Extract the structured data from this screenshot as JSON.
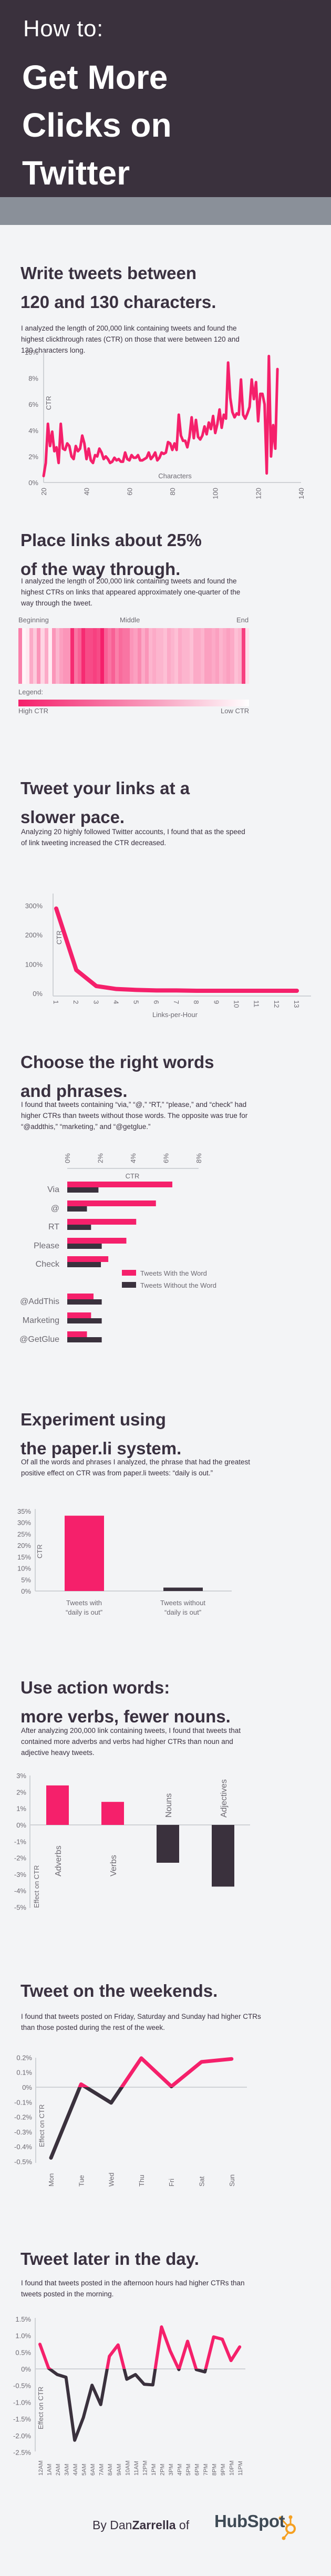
{
  "header": {
    "pretitle": "How to:",
    "title_lines": [
      "Get More",
      "Clicks on",
      "Twitter"
    ]
  },
  "colors": {
    "accent": "#f5206b",
    "dark": "#3a313d",
    "band": "#8a9099",
    "background": "#f3f4f6",
    "hubspot_orange": "#f5a022"
  },
  "sections": [
    {
      "title_lines": [
        "Write tweets between",
        "120 and 130 characters."
      ],
      "body": "I analyzed the length of 200,000 link containing tweets and found the highest clickthrough rates (CTR) on those that were between 120 and 130 characters long."
    },
    {
      "title_lines": [
        "Place links about 25%",
        "of the way through."
      ],
      "body": "I analyzed the length of 200,000 link containing tweets and found the highest CTRs on links that appeared approximately one-quarter of the way through the tweet."
    },
    {
      "title_lines": [
        "Tweet your links at a",
        "slower pace."
      ],
      "body": "Analyzing 20 highly followed Twitter accounts, I found that as the speed of link tweeting increased the CTR decreased."
    },
    {
      "title_lines": [
        "Choose the right words",
        "and phrases."
      ],
      "body": "I found that tweets containing “via,” “@,” “RT,” “please,” and “check” had higher CTRs than tweets without those words. The opposite was true for “@addthis,” “marketing,” and “@getglue.”"
    },
    {
      "title_lines": [
        "Experiment using",
        "the paper.li system."
      ],
      "body": "Of all the words and phrases I analyzed, the phrase that had the greatest positive effect on CTR was from paper.li tweets: “daily is out.”"
    },
    {
      "title_lines": [
        "Use action words:",
        "more verbs, fewer nouns."
      ],
      "body": "After analyzing 200,000 link containing tweets, I found that tweets that contained more adverbs and verbs had higher CTRs than noun and adjective heavy tweets."
    },
    {
      "title_lines": [
        "Tweet on the weekends."
      ],
      "body": "I found that tweets posted on Friday, Saturday and Sunday had higher CTRs than those posted during the rest of the week."
    },
    {
      "title_lines": [
        "Tweet later in the day."
      ],
      "body": "I found that tweets posted in the afternoon hours had higher CTRs than tweets posted in the morning."
    }
  ],
  "chart_data": [
    {
      "id": "length",
      "type": "line",
      "title": "",
      "xlabel": "Characters",
      "ylabel": "CTR",
      "xlim": [
        20,
        140
      ],
      "ylim": [
        0,
        10
      ],
      "xticks": [
        "20",
        "40",
        "60",
        "80",
        "100",
        "120",
        "140"
      ],
      "yticks": [
        "0%",
        "2%",
        "4%",
        "6%",
        "8%",
        "10%"
      ],
      "x": [
        20,
        21,
        22,
        23,
        24,
        25,
        26,
        27,
        28,
        29,
        30,
        31,
        32,
        33,
        34,
        35,
        36,
        37,
        38,
        39,
        40,
        41,
        42,
        43,
        44,
        45,
        46,
        47,
        48,
        49,
        50,
        51,
        52,
        53,
        54,
        55,
        56,
        57,
        58,
        59,
        60,
        61,
        62,
        63,
        64,
        65,
        66,
        67,
        68,
        69,
        70,
        71,
        72,
        73,
        74,
        75,
        76,
        77,
        78,
        79,
        80,
        81,
        82,
        83,
        84,
        85,
        86,
        87,
        88,
        89,
        90,
        91,
        92,
        93,
        94,
        95,
        96,
        97,
        98,
        99,
        100,
        101,
        102,
        103,
        104,
        105,
        106,
        107,
        108,
        109,
        110,
        111,
        112,
        113,
        114,
        115,
        116,
        117,
        118,
        119,
        120,
        121,
        122,
        123,
        124,
        125,
        126,
        127,
        128,
        129,
        130,
        131,
        132,
        133,
        134,
        135,
        136,
        137,
        138,
        139,
        140
      ],
      "values": [
        0.5,
        1.5,
        4.5,
        2.8,
        3.9,
        2.4,
        2.7,
        1.5,
        4.5,
        2.6,
        2.5,
        3.0,
        2.8,
        2.0,
        1.8,
        2.8,
        2.4,
        2.6,
        3.6,
        3.0,
        1.8,
        2.6,
        1.7,
        1.5,
        2.1,
        2.0,
        2.6,
        2.3,
        1.8,
        2.0,
        1.8,
        1.5,
        1.6,
        1.9,
        1.7,
        1.8,
        1.6,
        1.6,
        2.3,
        1.8,
        1.7,
        2.1,
        1.9,
        1.9,
        2.1,
        1.7,
        1.7,
        1.8,
        1.9,
        2.3,
        1.8,
        2.0,
        2.3,
        1.7,
        1.9,
        2.3,
        2.2,
        2.3,
        3.1,
        3.0,
        2.5,
        3.0,
        2.5,
        5.2,
        3.6,
        3.2,
        3.2,
        2.7,
        3.5,
        5.0,
        3.4,
        4.8,
        3.5,
        3.3,
        3.6,
        4.3,
        3.7,
        4.6,
        4.1,
        5.1,
        3.8,
        4.5,
        5.6,
        4.2,
        5.2,
        4.9,
        9.2,
        6.5,
        5.4,
        5.0,
        5.3,
        5.2,
        7.9,
        5.2,
        4.9,
        5.3,
        5.8,
        7.9,
        6.4,
        7.7,
        4.7,
        6.8,
        6.8,
        6.0,
        0.7,
        9.7,
        2.0,
        4.4,
        2.6,
        8.7
      ],
      "grid": false
    },
    {
      "id": "position",
      "type": "heatmap",
      "labels_top": [
        "Beginning",
        "Middle",
        "End"
      ],
      "legend_title": "Legend:",
      "legend_high": "High CTR",
      "legend_low": "Low CTR",
      "intensity": [
        0.55,
        0.0,
        0.05,
        0.35,
        0.2,
        0.45,
        0.15,
        0.35,
        0.05,
        0.45,
        0.3,
        0.4,
        0.45,
        0.45,
        0.95,
        0.6,
        0.7,
        0.95,
        0.8,
        0.8,
        0.85,
        0.8,
        1.0,
        0.7,
        0.6,
        0.7,
        0.55,
        0.65,
        0.6,
        0.6,
        0.45,
        0.4,
        0.5,
        0.35,
        0.45,
        0.3,
        0.35,
        0.3,
        0.3,
        0.25,
        0.35,
        0.3,
        0.25,
        0.35,
        0.3,
        0.3,
        0.25,
        0.35,
        0.35,
        0.3,
        0.4,
        0.4,
        0.35,
        0.4,
        0.3,
        0.35,
        0.4,
        0.35,
        0.25,
        0.3,
        0.85,
        0.1
      ]
    },
    {
      "id": "pace",
      "type": "line",
      "xlabel": "Links-per-Hour",
      "ylabel": "CTR",
      "ylim": [
        0,
        300
      ],
      "yticks": [
        "0%",
        "100%",
        "200%",
        "300%"
      ],
      "x": [
        "1",
        "2",
        "3",
        "4",
        "5",
        "6",
        "7",
        "8",
        "9",
        "10",
        "11",
        "12",
        "13"
      ],
      "values": [
        290,
        80,
        25,
        15,
        12,
        10,
        10,
        9,
        9,
        9,
        9,
        9,
        9
      ]
    },
    {
      "id": "words",
      "type": "bar",
      "orientation": "horizontal",
      "xlabel": "CTR",
      "xlim": [
        0,
        8
      ],
      "xticks": [
        "0%",
        "2%",
        "4%",
        "6%",
        "8%"
      ],
      "categories": [
        "Via",
        "@",
        "RT",
        "Please",
        "Check",
        "@AddThis",
        "Marketing",
        "@GetGlue"
      ],
      "series": [
        {
          "name": "Tweets With the Word",
          "values": [
            6.4,
            5.4,
            4.2,
            3.6,
            2.5,
            1.6,
            1.45,
            1.2
          ]
        },
        {
          "name": "Tweets Without the Word",
          "values": [
            1.9,
            1.2,
            1.45,
            2.1,
            2.05,
            2.1,
            2.1,
            2.1
          ]
        }
      ],
      "legend": "right"
    },
    {
      "id": "paperli",
      "type": "bar",
      "ylabel": "CTR",
      "ylim": [
        0,
        35
      ],
      "yticks": [
        "0%",
        "5%",
        "10%",
        "15%",
        "20%",
        "25%",
        "30%",
        "35%"
      ],
      "categories": [
        [
          "Tweets with",
          "“daily is out”"
        ],
        [
          "Tweets without",
          "“daily is out”"
        ]
      ],
      "values": [
        33,
        1.5
      ]
    },
    {
      "id": "pos",
      "type": "bar",
      "ylabel": "Effect on CTR",
      "ylim": [
        -5,
        3
      ],
      "yticks": [
        "3%",
        "2%",
        "1%",
        "0%",
        "-1%",
        "-2%",
        "-3%",
        "-4%",
        "-5%"
      ],
      "categories": [
        "Adverbs",
        "Verbs",
        "Nouns",
        "Adjectives"
      ],
      "values": [
        2.4,
        1.4,
        -2.3,
        -3.75
      ]
    },
    {
      "id": "weekday",
      "type": "line",
      "ylabel": "Effect on CTR",
      "ylim": [
        -0.5,
        0.2
      ],
      "yticks": [
        "0.2%",
        "0.1%",
        "0%",
        "-0.1%",
        "-0.2%",
        "-0.3%",
        "-0.4%",
        "-0.5%"
      ],
      "x": [
        "Mon",
        "Tue",
        "Wed",
        "Thu",
        "Fri",
        "Sat",
        "Sun"
      ],
      "values": [
        -0.475,
        0.02,
        -0.105,
        0.195,
        0.005,
        0.17,
        0.19
      ]
    },
    {
      "id": "hour",
      "type": "line",
      "ylabel": "Effect on CTR",
      "ylim": [
        -2.5,
        1.5
      ],
      "yticks": [
        "1.5%",
        "1.0%",
        "0.5%",
        "0%",
        "-0.5%",
        "-1.0%",
        "-1.5%",
        "-2.0%",
        "-2.5%"
      ],
      "x": [
        "12AM",
        "1AM",
        "2AM",
        "3AM",
        "4AM",
        "5AM",
        "6AM",
        "7AM",
        "8AM",
        "9AM",
        "10AM",
        "11AM",
        "12PM",
        "1PM",
        "2PM",
        "3PM",
        "4PM",
        "5PM",
        "6PM",
        "7PM",
        "8PM",
        "9PM",
        "10PM",
        "11PM"
      ],
      "values": [
        0.74,
        0.02,
        -0.17,
        -0.25,
        -2.14,
        -1.46,
        -0.49,
        -1.07,
        0.38,
        0.72,
        -0.31,
        -0.17,
        -0.46,
        -0.48,
        1.26,
        0.54,
        -0.02,
        0.83,
        -0.02,
        -0.09,
        0.96,
        0.89,
        0.25,
        0.66
      ]
    }
  ],
  "footer": {
    "by": "By Dan",
    "author_bold": "Zarrella",
    "of": " of",
    "brand": "HubSpot"
  }
}
